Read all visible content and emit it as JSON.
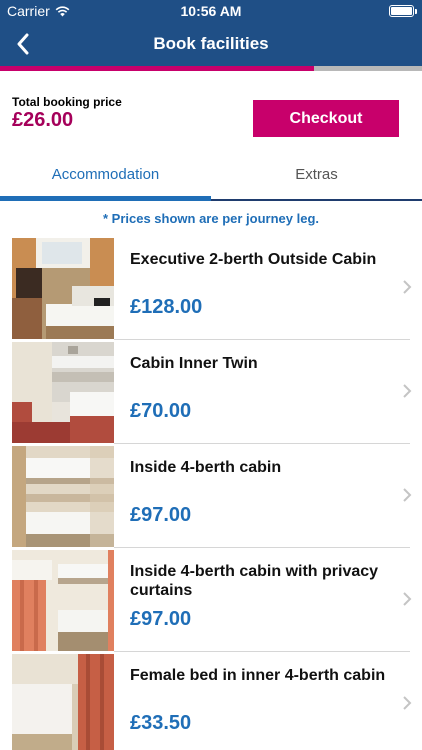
{
  "status_bar": {
    "carrier": "Carrier",
    "time": "10:56 AM"
  },
  "nav": {
    "title": "Book facilities",
    "back_icon": "chevron-left-icon"
  },
  "progress": {
    "fraction": 0.745,
    "fill_color": "#c8006b"
  },
  "summary": {
    "total_label": "Total booking price",
    "total_value": "£26.00",
    "checkout_label": "Checkout"
  },
  "tabs": [
    {
      "label": "Accommodation",
      "active": true
    },
    {
      "label": "Extras",
      "active": false
    }
  ],
  "note": "* Prices shown are per journey leg.",
  "items": [
    {
      "title": "Executive 2-berth Outside Cabin",
      "price": "£128.00",
      "image": "cabin-photo"
    },
    {
      "title": "Cabin Inner Twin",
      "price": "£70.00",
      "image": "cabin-photo"
    },
    {
      "title": "Inside 4-berth cabin",
      "price": "£97.00",
      "image": "cabin-photo"
    },
    {
      "title": "Inside 4-berth cabin with privacy curtains",
      "price": "£97.00",
      "image": "cabin-photo"
    },
    {
      "title": "Female bed in inner 4-berth cabin",
      "price": "£33.50",
      "image": "cabin-photo"
    }
  ],
  "colors": {
    "header": "#1f4f86",
    "accent": "#c8006b",
    "price_blue": "#1f6eb7",
    "total_price": "#a5005a"
  }
}
